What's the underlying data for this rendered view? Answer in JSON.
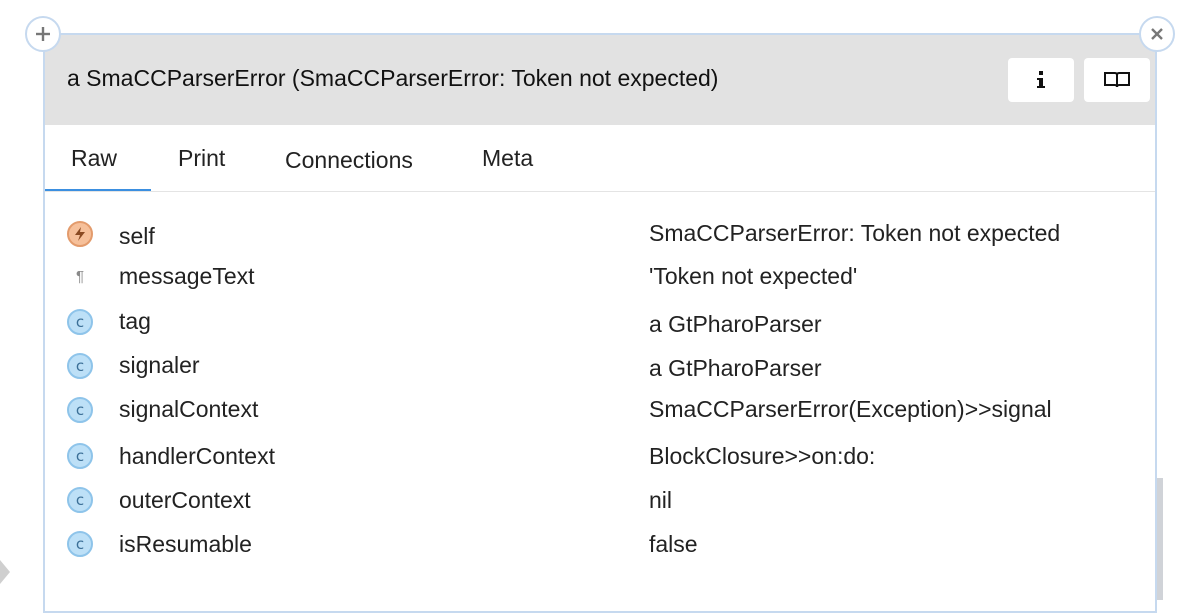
{
  "window": {
    "title": "a SmaCCParserError (SmaCCParserError: Token not expected)"
  },
  "tabs": [
    {
      "label": "Raw",
      "active": true
    },
    {
      "label": "Print",
      "active": false
    },
    {
      "label": "Connections",
      "active": false
    },
    {
      "label": "Meta",
      "active": false
    }
  ],
  "rows": [
    {
      "icon": "bolt-icon",
      "name": "self",
      "value": "SmaCCParserError: Token not expected"
    },
    {
      "icon": "pilcrow-icon",
      "name": "messageText",
      "value": "'Token not expected'"
    },
    {
      "icon": "class-icon",
      "name": "tag",
      "value": "a GtPharoParser"
    },
    {
      "icon": "class-icon",
      "name": "signaler",
      "value": "a GtPharoParser"
    },
    {
      "icon": "class-icon",
      "name": "signalContext",
      "value": "SmaCCParserError(Exception)>>signal"
    },
    {
      "icon": "class-icon",
      "name": "handlerContext",
      "value": "BlockClosure>>on:do:"
    },
    {
      "icon": "class-icon",
      "name": "outerContext",
      "value": "nil"
    },
    {
      "icon": "class-icon",
      "name": "isResumable",
      "value": "false"
    }
  ],
  "colors": {
    "accent": "#3b8fe0",
    "header_bg": "#e2e2e2",
    "window_border": "#c6d9ef"
  }
}
